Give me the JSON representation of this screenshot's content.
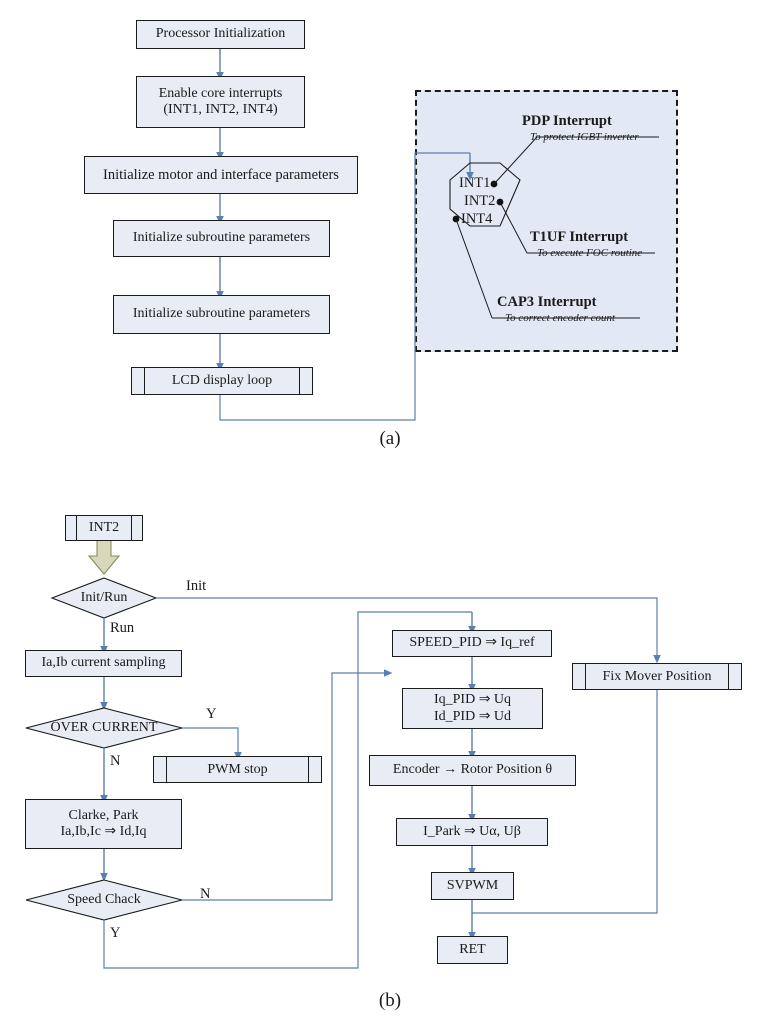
{
  "figure": {
    "caption_a": "(a)",
    "caption_b": "(b)"
  },
  "diagram_a": {
    "nodes": [
      {
        "id": "processor-init",
        "label": "Processor Initialization",
        "shape": "process"
      },
      {
        "id": "enable-core-interrupts",
        "label": "Enable core interrupts\n(INT1, INT2, INT4)",
        "line1": "Enable core interrupts",
        "line2": "(INT1, INT2, INT4)",
        "shape": "process"
      },
      {
        "id": "init-motor-interface",
        "label": "Initialize motor and interface parameters",
        "shape": "process"
      },
      {
        "id": "init-subroutine-1",
        "label": "Initialize subroutine parameters",
        "shape": "process"
      },
      {
        "id": "init-subroutine-2",
        "label": "Initialize subroutine parameters",
        "shape": "process"
      },
      {
        "id": "lcd-display-loop",
        "label": "LCD display loop",
        "shape": "predefined-process"
      }
    ],
    "interrupt_panel": {
      "hexagon_labels": [
        "INT1",
        "INT2",
        "INT4"
      ],
      "interrupts": [
        {
          "title": "PDP Interrupt",
          "subtitle": "To protect IGBT inverter"
        },
        {
          "title": "T1UF Interrupt",
          "subtitle": "To execute FOC routine"
        },
        {
          "title": "CAP3 Interrupt",
          "subtitle": "To correct encoder count"
        }
      ]
    }
  },
  "diagram_b": {
    "nodes": [
      {
        "id": "int2-entry",
        "label": "INT2",
        "shape": "predefined-process"
      },
      {
        "id": "init-run-decision",
        "label": "Init/Run",
        "shape": "decision"
      },
      {
        "id": "current-sampling",
        "label": "Ia,Ib current sampling",
        "shape": "process"
      },
      {
        "id": "over-current-decision",
        "label": "OVER CURRENT",
        "shape": "decision"
      },
      {
        "id": "pwm-stop",
        "label": "PWM stop",
        "shape": "predefined-process"
      },
      {
        "id": "clarke-park",
        "line1": "Clarke, Park",
        "line2": "Ia,Ib,Ic ⇒ Id,Iq",
        "shape": "process"
      },
      {
        "id": "speed-chack-decision",
        "label": "Speed Chack",
        "shape": "decision"
      },
      {
        "id": "speed-pid",
        "label": "SPEED_PID ⇒ Iq_ref",
        "shape": "process"
      },
      {
        "id": "iq-id-pid",
        "line1": "Iq_PID ⇒ Uq",
        "line2": "Id_PID ⇒ Ud",
        "shape": "process"
      },
      {
        "id": "encoder-rotor-position",
        "label": "Encoder → Rotor Position θ",
        "shape": "process"
      },
      {
        "id": "inverse-park",
        "label": "I_Park ⇒ Uα, Uβ",
        "shape": "process"
      },
      {
        "id": "svpwm",
        "label": "SVPWM",
        "shape": "process"
      },
      {
        "id": "ret",
        "label": "RET",
        "shape": "process"
      },
      {
        "id": "fix-mover-position",
        "label": "Fix Mover Position",
        "shape": "predefined-process"
      }
    ],
    "edge_labels": [
      {
        "id": "edge-init",
        "text": "Init"
      },
      {
        "id": "edge-run",
        "text": "Run"
      },
      {
        "id": "edge-overcurrent-yes",
        "text": "Y"
      },
      {
        "id": "edge-overcurrent-no",
        "text": "N"
      },
      {
        "id": "edge-speed-no",
        "text": "N"
      },
      {
        "id": "edge-speed-yes",
        "text": "Y"
      }
    ]
  },
  "colors": {
    "node_fill": "#e7ecf5",
    "node_border": "#1b1b1b",
    "connector": "#5b7fb0",
    "connector_dark": "#2f5a92",
    "panel_fill": "#e3e9f4",
    "block_arrow_fill": "#d8d8bb",
    "block_arrow_border": "#8a8a63"
  }
}
